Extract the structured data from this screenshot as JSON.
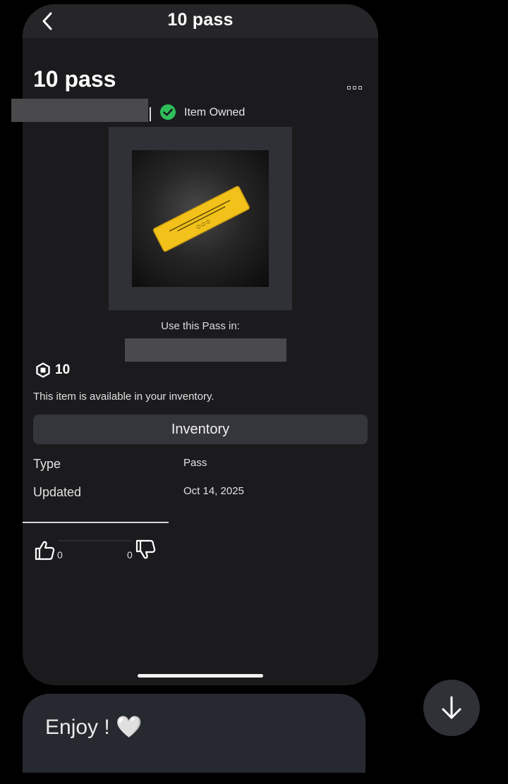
{
  "topbar": {
    "title": "10 pass"
  },
  "item": {
    "title": "10 pass",
    "owned_label": "Item Owned",
    "use_pass_label": "Use this Pass in:",
    "price": "10",
    "availability": "This item is available in your inventory.",
    "inventory_button": "Inventory"
  },
  "details": [
    {
      "label": "Type",
      "value": "Pass"
    },
    {
      "label": "Updated",
      "value": "Oct 14, 2025"
    }
  ],
  "votes": {
    "up": "0",
    "down": "0"
  },
  "message": {
    "text": "Enjoy ! 🤍"
  },
  "colors": {
    "owned_green": "#2ebf5a",
    "pass_gold": "#f2c21b",
    "background": "#1b1b1e"
  }
}
